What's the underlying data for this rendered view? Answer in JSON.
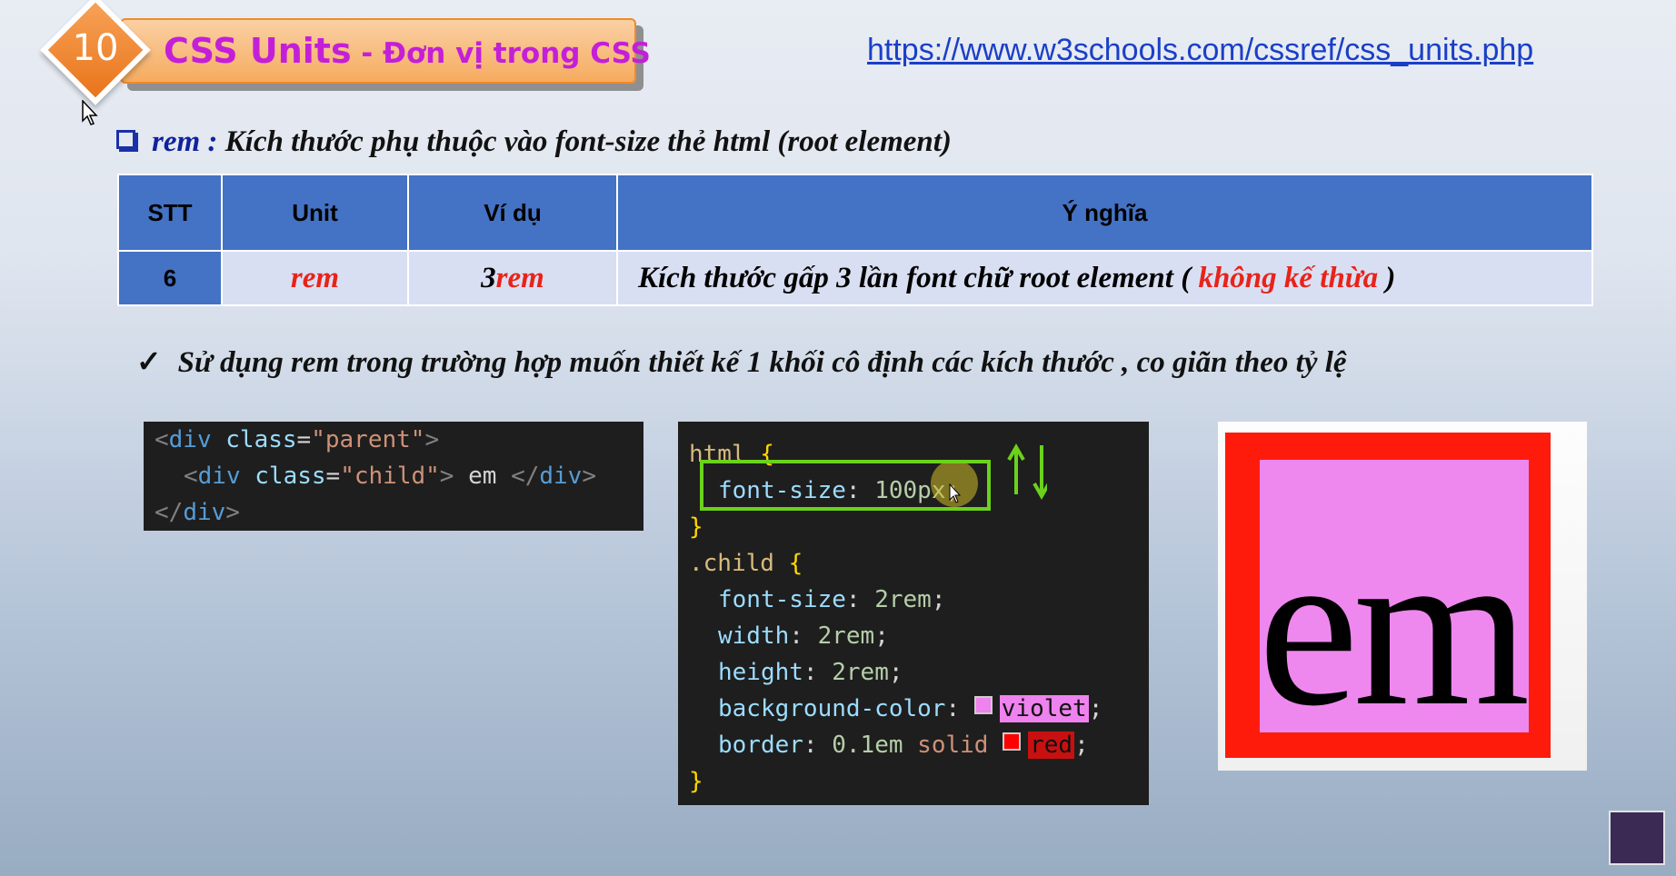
{
  "header": {
    "lesson_number": "10",
    "title_main": "CSS Units",
    "title_sub": " - Đơn vị trong CSS",
    "url": "https://www.w3schools.com/cssref/css_units.php"
  },
  "heading": {
    "keyword": "rem :",
    "text": " Kích thước phụ thuộc vào font-size thẻ html (root element)"
  },
  "table": {
    "headers": [
      "STT",
      "Unit",
      "Ví dụ",
      "Ý nghĩa"
    ],
    "row": {
      "stt": "6",
      "unit": "rem",
      "example_num": "3",
      "example_unit": "rem",
      "meaning_before": "Kích thước gấp 3 lần font chữ root element ( ",
      "meaning_highlight": "không kế thừa",
      "meaning_after": " )"
    }
  },
  "note": {
    "check": "✓",
    "text": "Sử dụng rem trong trường hợp muốn thiết kế 1 khối cô định các kích thước , co giãn theo tỷ lệ"
  },
  "html_code": {
    "line1": {
      "open": "<",
      "tag": "div",
      "attr": " class",
      "eq": "=",
      "val": "\"parent\"",
      "close": ">"
    },
    "line2": {
      "open": "<",
      "tag": "div",
      "attr": " class",
      "eq": "=",
      "val": "\"child\"",
      "close": ">",
      "text": " em ",
      "end_open": "</",
      "end_tag": "div",
      "end_close": ">"
    },
    "line3": {
      "open": "</",
      "tag": "div",
      "close": ">"
    }
  },
  "css_code": {
    "sel1": "html",
    "brace_open": " {",
    "p1": "font-size",
    "v1": "100px",
    "brace_close": "}",
    "sel2": ".child",
    "p2": "font-size",
    "v2": "2rem",
    "p3": "width",
    "v3": "2rem",
    "p4": "height",
    "v4": "2rem",
    "p5": "background-color",
    "v5": "violet",
    "p6": "border",
    "v6_num": "0.1em",
    "v6_style": "solid",
    "v6_color": "red",
    "semicolon": ";",
    "colon": ": "
  },
  "preview": {
    "text": "em",
    "border_color": "#ff1b0c",
    "background_color": "#ee88ee"
  },
  "colors": {
    "title": "#c41fd8",
    "table_header": "#4472c4",
    "table_row": "#d9dff2",
    "highlight_red": "#e8231a",
    "link": "#1a3fc7"
  }
}
